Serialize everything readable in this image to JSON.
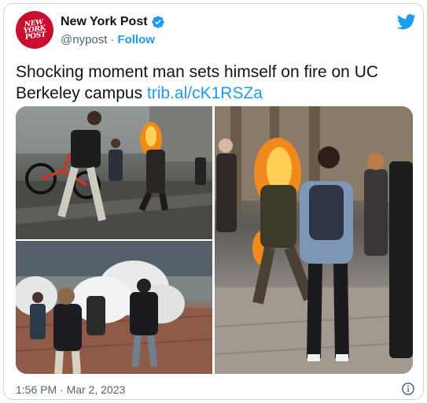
{
  "author": {
    "logo_text": "NEW YORK POST",
    "display_name": "New York Post",
    "handle": "@nypost",
    "separator": "·",
    "follow_label": "Follow"
  },
  "tweet": {
    "text": "Shocking moment man sets himself on fire on UC Berkeley campus ",
    "link": "trib.al/cK1RSZa",
    "timestamp": "1:56 PM · Mar 2, 2023"
  },
  "colors": {
    "link": "#1d9bf0",
    "brand_red": "#c8102e",
    "muted": "#536471"
  },
  "icons": {
    "verified": "verified-badge-icon",
    "twitter": "twitter-bird-icon",
    "info": "info-icon"
  }
}
